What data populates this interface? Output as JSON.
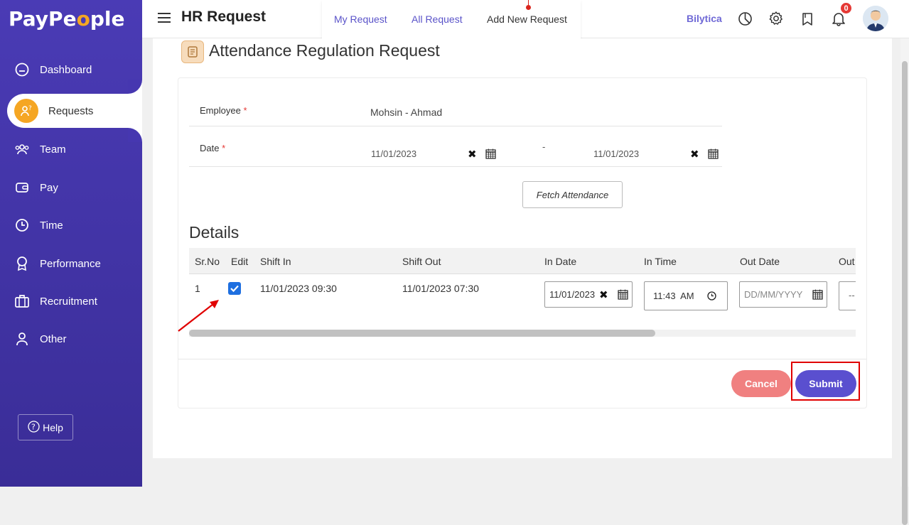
{
  "sidebar": {
    "logo_prefix": "PayPe",
    "logo_o": "o",
    "logo_suffix": "ple",
    "items": [
      {
        "label": "Dashboard",
        "icon": "dashboard-icon"
      },
      {
        "label": "Requests",
        "icon": "requests-icon",
        "active": true
      },
      {
        "label": "Team",
        "icon": "team-icon"
      },
      {
        "label": "Pay",
        "icon": "wallet-icon"
      },
      {
        "label": "Time",
        "icon": "clock-icon"
      },
      {
        "label": "Performance",
        "icon": "award-icon"
      },
      {
        "label": "Recruitment",
        "icon": "briefcase-icon"
      },
      {
        "label": "Other",
        "icon": "user-icon"
      }
    ],
    "help_label": "Help"
  },
  "header": {
    "title": "HR Request",
    "tabs": [
      {
        "label": "My Request"
      },
      {
        "label": "All Request"
      },
      {
        "label": "Add New Request",
        "active": true
      }
    ],
    "company": "Bilytica",
    "notification_count": "0"
  },
  "form": {
    "title": "Attendance Regulation Request",
    "employee_label": "Employee",
    "required_mark": "*",
    "employee_value": "Mohsin - Ahmad",
    "date_label": "Date",
    "date_from": "11/01/2023",
    "date_separator": "-",
    "date_to": "11/01/2023",
    "fetch_label": "Fetch Attendance"
  },
  "details": {
    "title": "Details",
    "columns": [
      "Sr.No",
      "Edit",
      "Shift In",
      "Shift Out",
      "In Date",
      "In Time",
      "Out Date",
      "Out"
    ],
    "rows": [
      {
        "sr": "1",
        "edit_checked": true,
        "shift_in": "11/01/2023 09:30",
        "shift_out": "11/01/2023 07:30",
        "in_date": "11/01/2023",
        "in_time": "11:43  AM",
        "out_date_placeholder": "DD/MM/YYYY",
        "out_partial": "--"
      }
    ]
  },
  "actions": {
    "cancel_label": "Cancel",
    "submit_label": "Submit"
  },
  "colors": {
    "sidebar": "#4a3bb5",
    "accent": "#5a4fcf",
    "cancel": "#f08080",
    "highlight": "#e00000"
  }
}
